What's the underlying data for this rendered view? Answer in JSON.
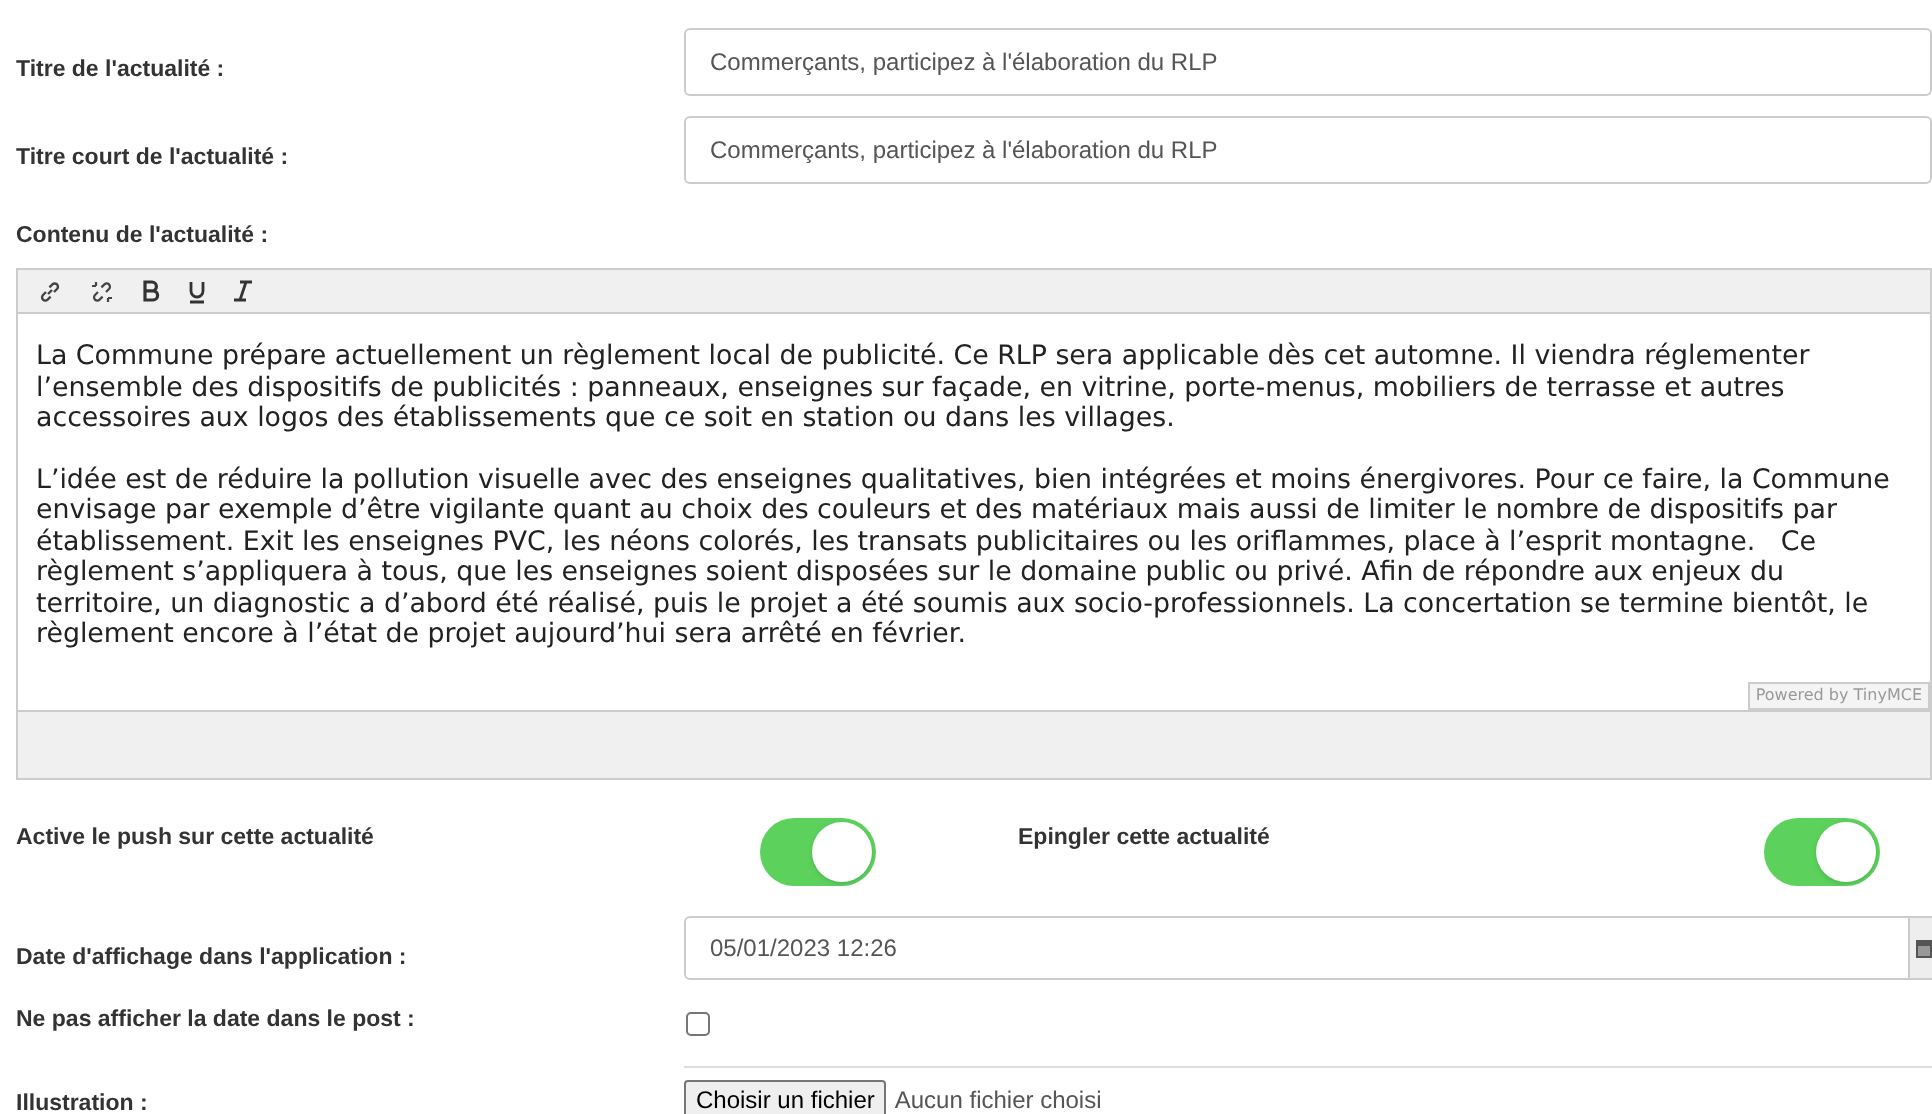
{
  "title_field": {
    "label": "Titre de l'actualité :",
    "value": "Commerçants, participez à l'élaboration du RLP"
  },
  "short_title_field": {
    "label": "Titre court de l'actualité :",
    "value": "Commerçants, participez à l'élaboration du RLP"
  },
  "content_editor": {
    "label": "Contenu de l'actualité :",
    "paragraphs": [
      "La Commune prépare actuellement un règlement local de publicité. Ce RLP sera applicable dès cet automne. Il viendra réglementer l’ensemble des dispositifs de publicités : panneaux, enseignes sur façade, en vitrine, porte-menus, mobiliers de terrasse et autres accessoires aux logos des établissements que ce soit en station ou dans les villages.",
      "L’idée est de réduire la pollution visuelle avec des enseignes qualitatives, bien intégrées et moins énergivores. Pour ce faire, la Commune envisage par exemple d’être vigilante quant au choix des couleurs et des matériaux mais aussi de limiter le nombre de dispositifs par établissement. Exit les enseignes PVC, les néons colorés, les transats publicitaires ou les oriflammes, place à l’esprit montagne.   Ce règlement s’appliquera à tous, que les enseignes soient disposées sur le domaine public ou privé. Afin de répondre aux enjeux du territoire, un diagnostic a d’abord été réalisé, puis le projet a été soumis aux socio-professionnels. La concertation se termine bientôt, le règlement encore à l’état de projet aujourd’hui sera arrêté en février."
    ],
    "powered_by": "Powered by TinyMCE"
  },
  "toggles": [
    {
      "label": "Active le push sur cette actualité",
      "on": true
    },
    {
      "label": "Epingler cette actualité",
      "on": true
    }
  ],
  "date_field": {
    "label": "Date d'affichage dans l'application :",
    "value": "05/01/2023 12:26"
  },
  "hide_date": {
    "label": "Ne pas afficher la date dans le post :",
    "checked": false
  },
  "illustration": {
    "label": "Illustration :",
    "button": "Choisir un fichier",
    "status": "Aucun fichier choisi"
  }
}
